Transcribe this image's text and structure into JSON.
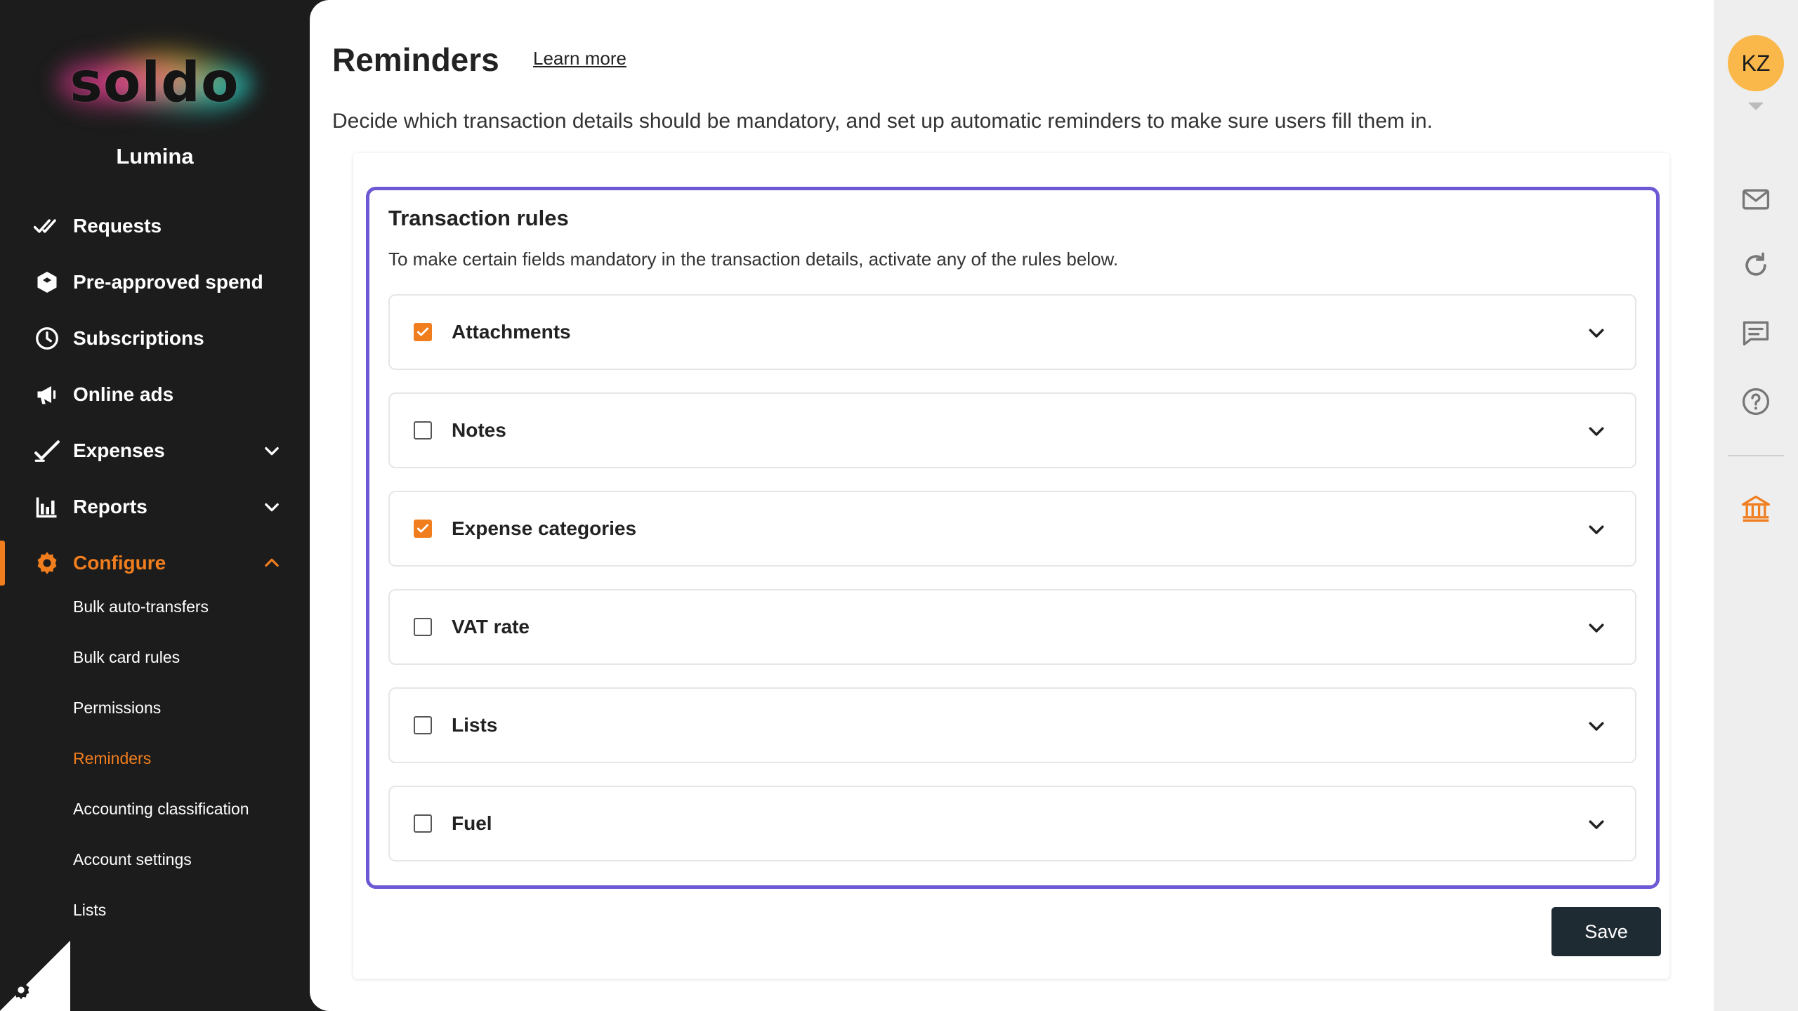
{
  "sidebar": {
    "logo_text": "soldo",
    "company_name": "Lumina",
    "nav": [
      {
        "label": "Requests",
        "icon": "double-check-icon"
      },
      {
        "label": "Pre-approved spend",
        "icon": "hexagon-icon"
      },
      {
        "label": "Subscriptions",
        "icon": "clock-icon"
      },
      {
        "label": "Online ads",
        "icon": "megaphone-icon"
      },
      {
        "label": "Expenses",
        "icon": "check-icon",
        "expandable": true
      },
      {
        "label": "Reports",
        "icon": "bar-chart-icon",
        "expandable": true
      },
      {
        "label": "Configure",
        "icon": "gear-icon",
        "expandable": true,
        "expanded": true,
        "active": true
      }
    ],
    "sub_items": [
      {
        "label": "Bulk auto-transfers"
      },
      {
        "label": "Bulk card rules"
      },
      {
        "label": "Permissions"
      },
      {
        "label": "Reminders",
        "active": true
      },
      {
        "label": "Accounting classification"
      },
      {
        "label": "Account settings"
      },
      {
        "label": "Lists"
      }
    ]
  },
  "header": {
    "title": "Reminders",
    "learn_more": "Learn more",
    "description": "Decide which transaction details should be mandatory, and set up automatic reminders to make sure users fill them in."
  },
  "rules": {
    "title": "Transaction rules",
    "description": "To make certain fields mandatory in the transaction details, activate any of the rules below.",
    "items": [
      {
        "label": "Attachments",
        "checked": true
      },
      {
        "label": "Notes",
        "checked": false
      },
      {
        "label": "Expense categories",
        "checked": true
      },
      {
        "label": "VAT rate",
        "checked": false
      },
      {
        "label": "Lists",
        "checked": false
      },
      {
        "label": "Fuel",
        "checked": false
      }
    ]
  },
  "actions": {
    "save_label": "Save"
  },
  "rail": {
    "avatar_initials": "KZ",
    "icons": [
      "mail-icon",
      "refresh-icon",
      "chat-icon",
      "help-icon",
      "bank-icon"
    ]
  },
  "colors": {
    "accent": "#f07d1e",
    "focus_border": "#6c5ad4",
    "sidebar_bg": "#1c1c1c",
    "button_bg": "#1f2b33",
    "avatar_bg": "#fbb84a"
  }
}
